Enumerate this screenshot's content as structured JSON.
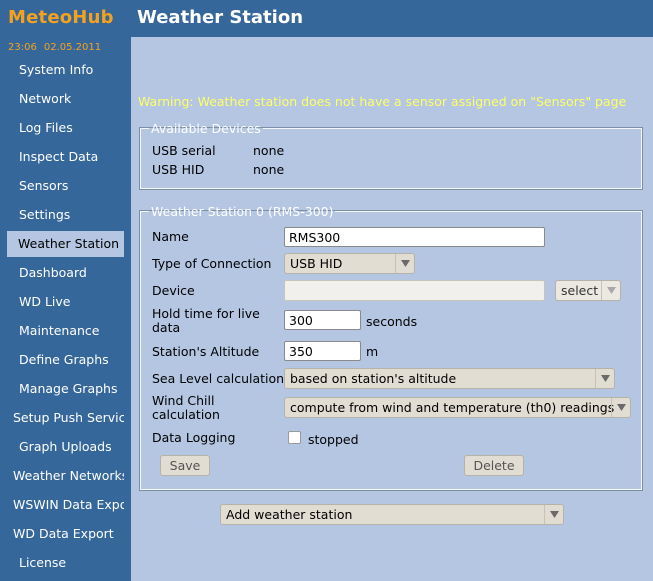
{
  "app": {
    "name": "MeteoHub",
    "time": "23:06",
    "date": "02.05.2011"
  },
  "sidebar": {
    "items": [
      {
        "label": "System Info"
      },
      {
        "label": "Network"
      },
      {
        "label": "Log Files"
      },
      {
        "label": "Inspect Data"
      },
      {
        "label": "Sensors"
      },
      {
        "label": "Settings"
      },
      {
        "label": "Weather Station",
        "active": true
      },
      {
        "label": "Dashboard"
      },
      {
        "label": "WD Live"
      },
      {
        "label": "Maintenance"
      },
      {
        "label": "Define Graphs"
      },
      {
        "label": "Manage Graphs"
      },
      {
        "label": "Setup Push Servic"
      },
      {
        "label": "Graph Uploads"
      },
      {
        "label": "Weather Networks"
      },
      {
        "label": "WSWIN Data Expo"
      },
      {
        "label": "WD Data Export"
      },
      {
        "label": "License"
      }
    ]
  },
  "page": {
    "title": "Weather Station",
    "warning": "Warning: Weather station does not have a sensor assigned on \"Sensors\" page"
  },
  "devices": {
    "legend": "Available Devices",
    "rows": [
      {
        "label": "USB serial",
        "value": "none"
      },
      {
        "label": "USB HID",
        "value": "none"
      }
    ]
  },
  "station": {
    "legend": "Weather Station 0 (RMS-300)",
    "name": {
      "label": "Name",
      "value": "RMS300"
    },
    "connection": {
      "label": "Type of Connection",
      "value": "USB HID"
    },
    "device": {
      "label": "Device",
      "value": "",
      "select_label": "select"
    },
    "hold_time": {
      "label": "Hold time for live data",
      "value": "300",
      "unit": "seconds"
    },
    "altitude": {
      "label": "Station's Altitude",
      "value": "350",
      "unit": "m"
    },
    "sea_level": {
      "label": "Sea Level calculation",
      "value": "based on station's altitude"
    },
    "wind_chill": {
      "label": "Wind Chill calculation",
      "value": "compute from wind and temperature (th0) readings"
    },
    "logging": {
      "label": "Data Logging",
      "checked": false,
      "status": "stopped"
    },
    "save_label": "Save",
    "delete_label": "Delete"
  },
  "add_station": {
    "value": "Add weather station"
  },
  "colors": {
    "sidebar_bg": "#36679b",
    "content_bg": "#b4c6e2",
    "brand": "#f4a21e",
    "warning": "#ffff66"
  }
}
